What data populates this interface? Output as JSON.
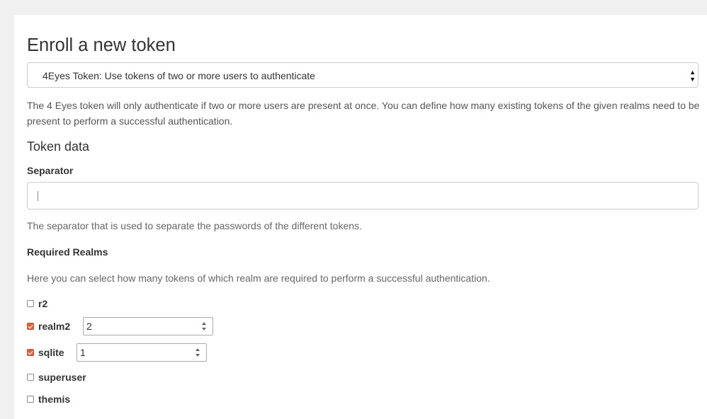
{
  "header": {
    "title": "Enroll a new token"
  },
  "token_type": {
    "selected": "4Eyes Token: Use tokens of two or more users to authenticate"
  },
  "description": "The 4 Eyes token will only authenticate if two or more users are present at once. You can define how many existing tokens of the given realms need to be present to perform a successful authentication.",
  "token_data": {
    "heading": "Token data",
    "separator": {
      "label": "Separator",
      "value": "",
      "help": "The separator that is used to separate the passwords of the different tokens."
    },
    "required_realms": {
      "label": "Required Realms",
      "help": "Here you can select how many tokens of which realm are required to perform a successful authentication.",
      "realms": [
        {
          "name": "r2",
          "checked": false,
          "count": ""
        },
        {
          "name": "realm2",
          "checked": true,
          "count": "2"
        },
        {
          "name": "sqlite",
          "checked": true,
          "count": "1"
        },
        {
          "name": "superuser",
          "checked": false,
          "count": ""
        },
        {
          "name": "themis",
          "checked": false,
          "count": ""
        }
      ]
    }
  },
  "colors": {
    "accent_checkbox": "#d9623f",
    "page_background": "#f0f0f0",
    "panel_background": "#ffffff"
  },
  "icons": {
    "select_arrow": "chevron-down-icon",
    "number_spinner": "spinner-arrows-icon",
    "checkbox": "checkbox-icon"
  }
}
